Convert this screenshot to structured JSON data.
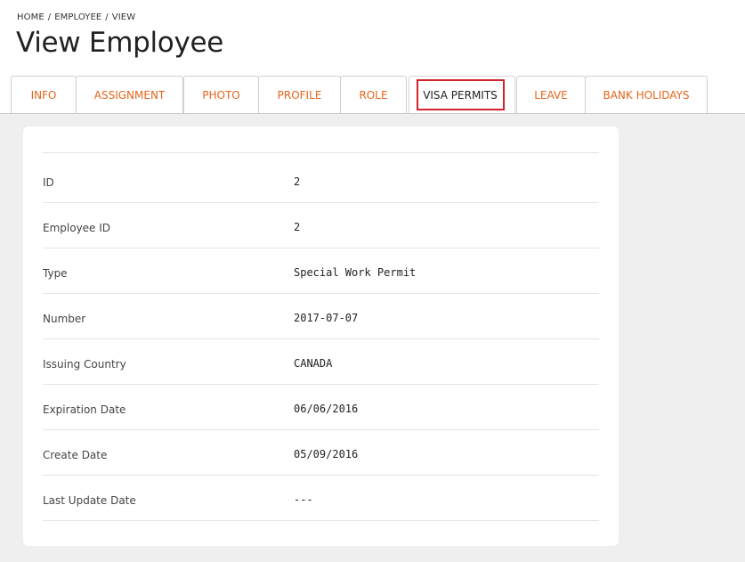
{
  "breadcrumb": [
    "HOME",
    "EMPLOYEE",
    "VIEW"
  ],
  "breadcrumb_separator": "/",
  "page_title": "View Employee",
  "tabs": [
    {
      "label": "INFO"
    },
    {
      "label": "ASSIGNMENT"
    },
    {
      "label": "PHOTO"
    },
    {
      "label": "PROFILE"
    },
    {
      "label": "ROLE"
    },
    {
      "label": "VISA PERMITS",
      "active": true
    },
    {
      "label": "LEAVE"
    },
    {
      "label": "BANK HOLIDAYS"
    }
  ],
  "colors": {
    "tab_text": "#e8641b",
    "active_tab_text": "#222222",
    "highlight_border": "#d2222a",
    "page_background": "#efefef"
  },
  "details": [
    {
      "label": "ID",
      "value": "2"
    },
    {
      "label": "Employee ID",
      "value": "2"
    },
    {
      "label": "Type",
      "value": "Special Work Permit"
    },
    {
      "label": "Number",
      "value": "2017-07-07"
    },
    {
      "label": "Issuing Country",
      "value": "CANADA"
    },
    {
      "label": "Expiration Date",
      "value": "06/06/2016"
    },
    {
      "label": "Create Date",
      "value": "05/09/2016"
    },
    {
      "label": "Last Update Date",
      "value": "---"
    }
  ]
}
